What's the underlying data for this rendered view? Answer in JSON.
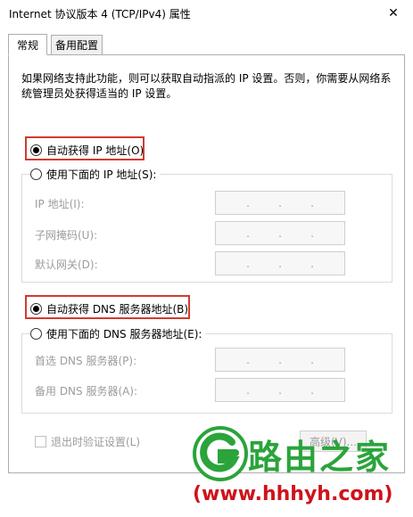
{
  "window": {
    "title": "Internet 协议版本 4 (TCP/IPv4) 属性",
    "close_glyph": "✕"
  },
  "tabs": [
    {
      "label": "常规",
      "active": true
    },
    {
      "label": "备用配置",
      "active": false
    }
  ],
  "description": "如果网络支持此功能，则可以获取自动指派的 IP 设置。否则，你需要从网络系统管理员处获得适当的 IP 设置。",
  "ip_section": {
    "auto_label": "自动获得 IP 地址(O)",
    "auto_selected": true,
    "manual_label": "使用下面的 IP 地址(S):",
    "fields": [
      {
        "label": "IP 地址(I):",
        "dots": [
          ".",
          ".",
          "."
        ]
      },
      {
        "label": "子网掩码(U):",
        "dots": [
          ".",
          ".",
          "."
        ]
      },
      {
        "label": "默认网关(D):",
        "dots": [
          ".",
          ".",
          "."
        ]
      }
    ]
  },
  "dns_section": {
    "auto_label": "自动获得 DNS 服务器地址(B)",
    "auto_selected": true,
    "manual_label": "使用下面的 DNS 服务器地址(E):",
    "fields": [
      {
        "label": "首选 DNS 服务器(P):",
        "dots": [
          ".",
          ".",
          "."
        ]
      },
      {
        "label": "备用 DNS 服务器(A):",
        "dots": [
          ".",
          ".",
          "."
        ]
      }
    ]
  },
  "validate_label": "退出时验证设置(L)",
  "advanced_button": "高级(V)...",
  "watermark": {
    "brand": "路由之家",
    "url": "(www.hhhyh.com)"
  },
  "colors": {
    "highlight_box": "#d23b2e",
    "watermark_green": "#2aa43b",
    "watermark_red": "#d0121b"
  }
}
